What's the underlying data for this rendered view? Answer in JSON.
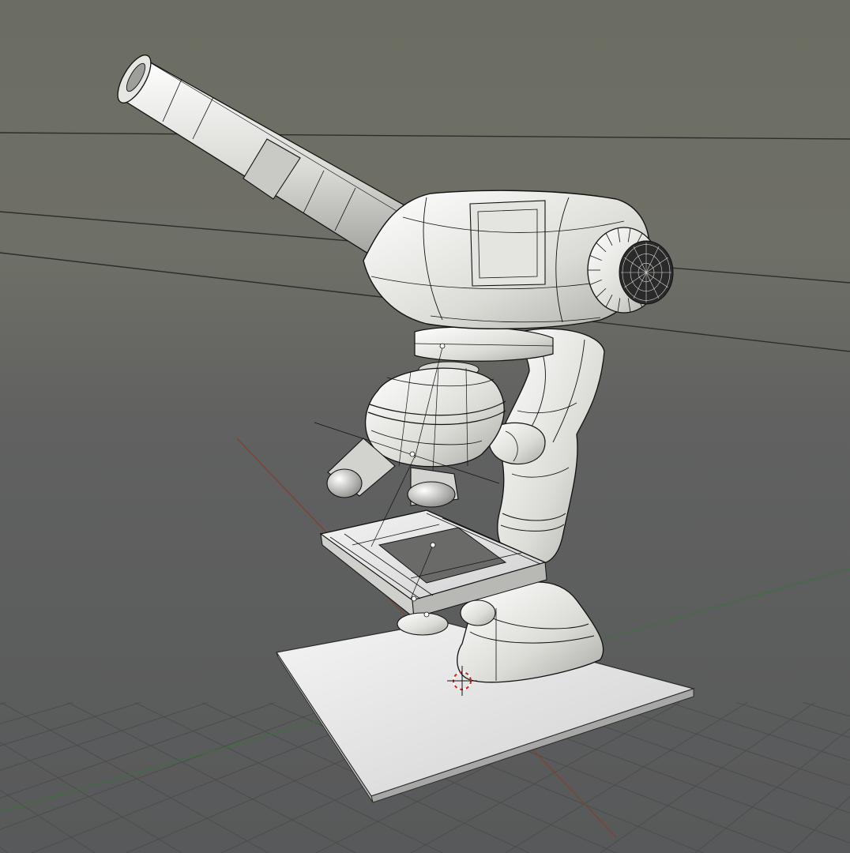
{
  "app": {
    "view": "3D Viewport",
    "object": "microscope",
    "shading": "solid",
    "overlay": "wireframe",
    "grid": true
  },
  "colors": {
    "background_top": "#6f7064",
    "background_bottom": "#595a5a",
    "grid_line": "#4a4b4b",
    "axis_x": "#8a4a3c",
    "axis_y": "#3e7a3e",
    "mesh": "#f2f2ef",
    "mesh_shadow": "#b9bab6",
    "wire": "#111111",
    "cursor": "#cc2222"
  },
  "icons": {
    "cursor": "3d-cursor-icon"
  }
}
